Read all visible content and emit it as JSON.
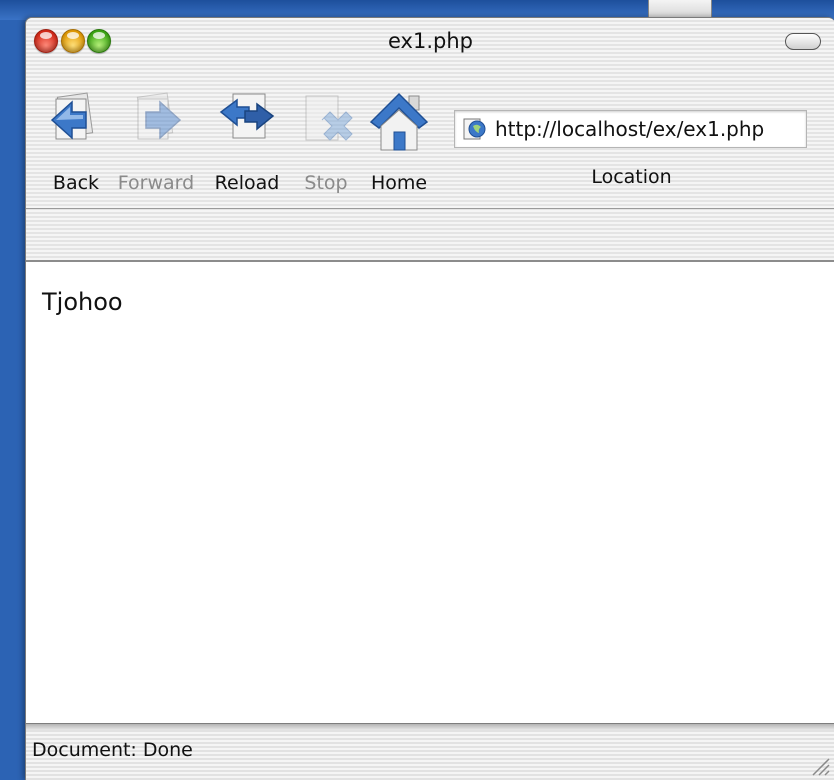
{
  "window": {
    "title": "ex1.php"
  },
  "toolbar": {
    "buttons": [
      {
        "label": "Back",
        "icon": "back-arrow-icon",
        "enabled": true
      },
      {
        "label": "Forward",
        "icon": "forward-arrow-icon",
        "enabled": false
      },
      {
        "label": "Reload",
        "icon": "reload-icon",
        "enabled": true
      },
      {
        "label": "Stop",
        "icon": "stop-icon",
        "enabled": false
      },
      {
        "label": "Home",
        "icon": "home-icon",
        "enabled": true
      }
    ],
    "location": {
      "url": "http://localhost/ex/ex1.php",
      "label": "Location",
      "icon": "site-globe-icon"
    }
  },
  "content": {
    "text": "Tjohoo"
  },
  "status": {
    "text": "Document: Done"
  },
  "colors": {
    "desktop": "#2c63b4",
    "close": "#d42a1a",
    "minimize": "#e19a06",
    "zoom": "#3ca614",
    "icon_blue": "#3c78c8"
  }
}
